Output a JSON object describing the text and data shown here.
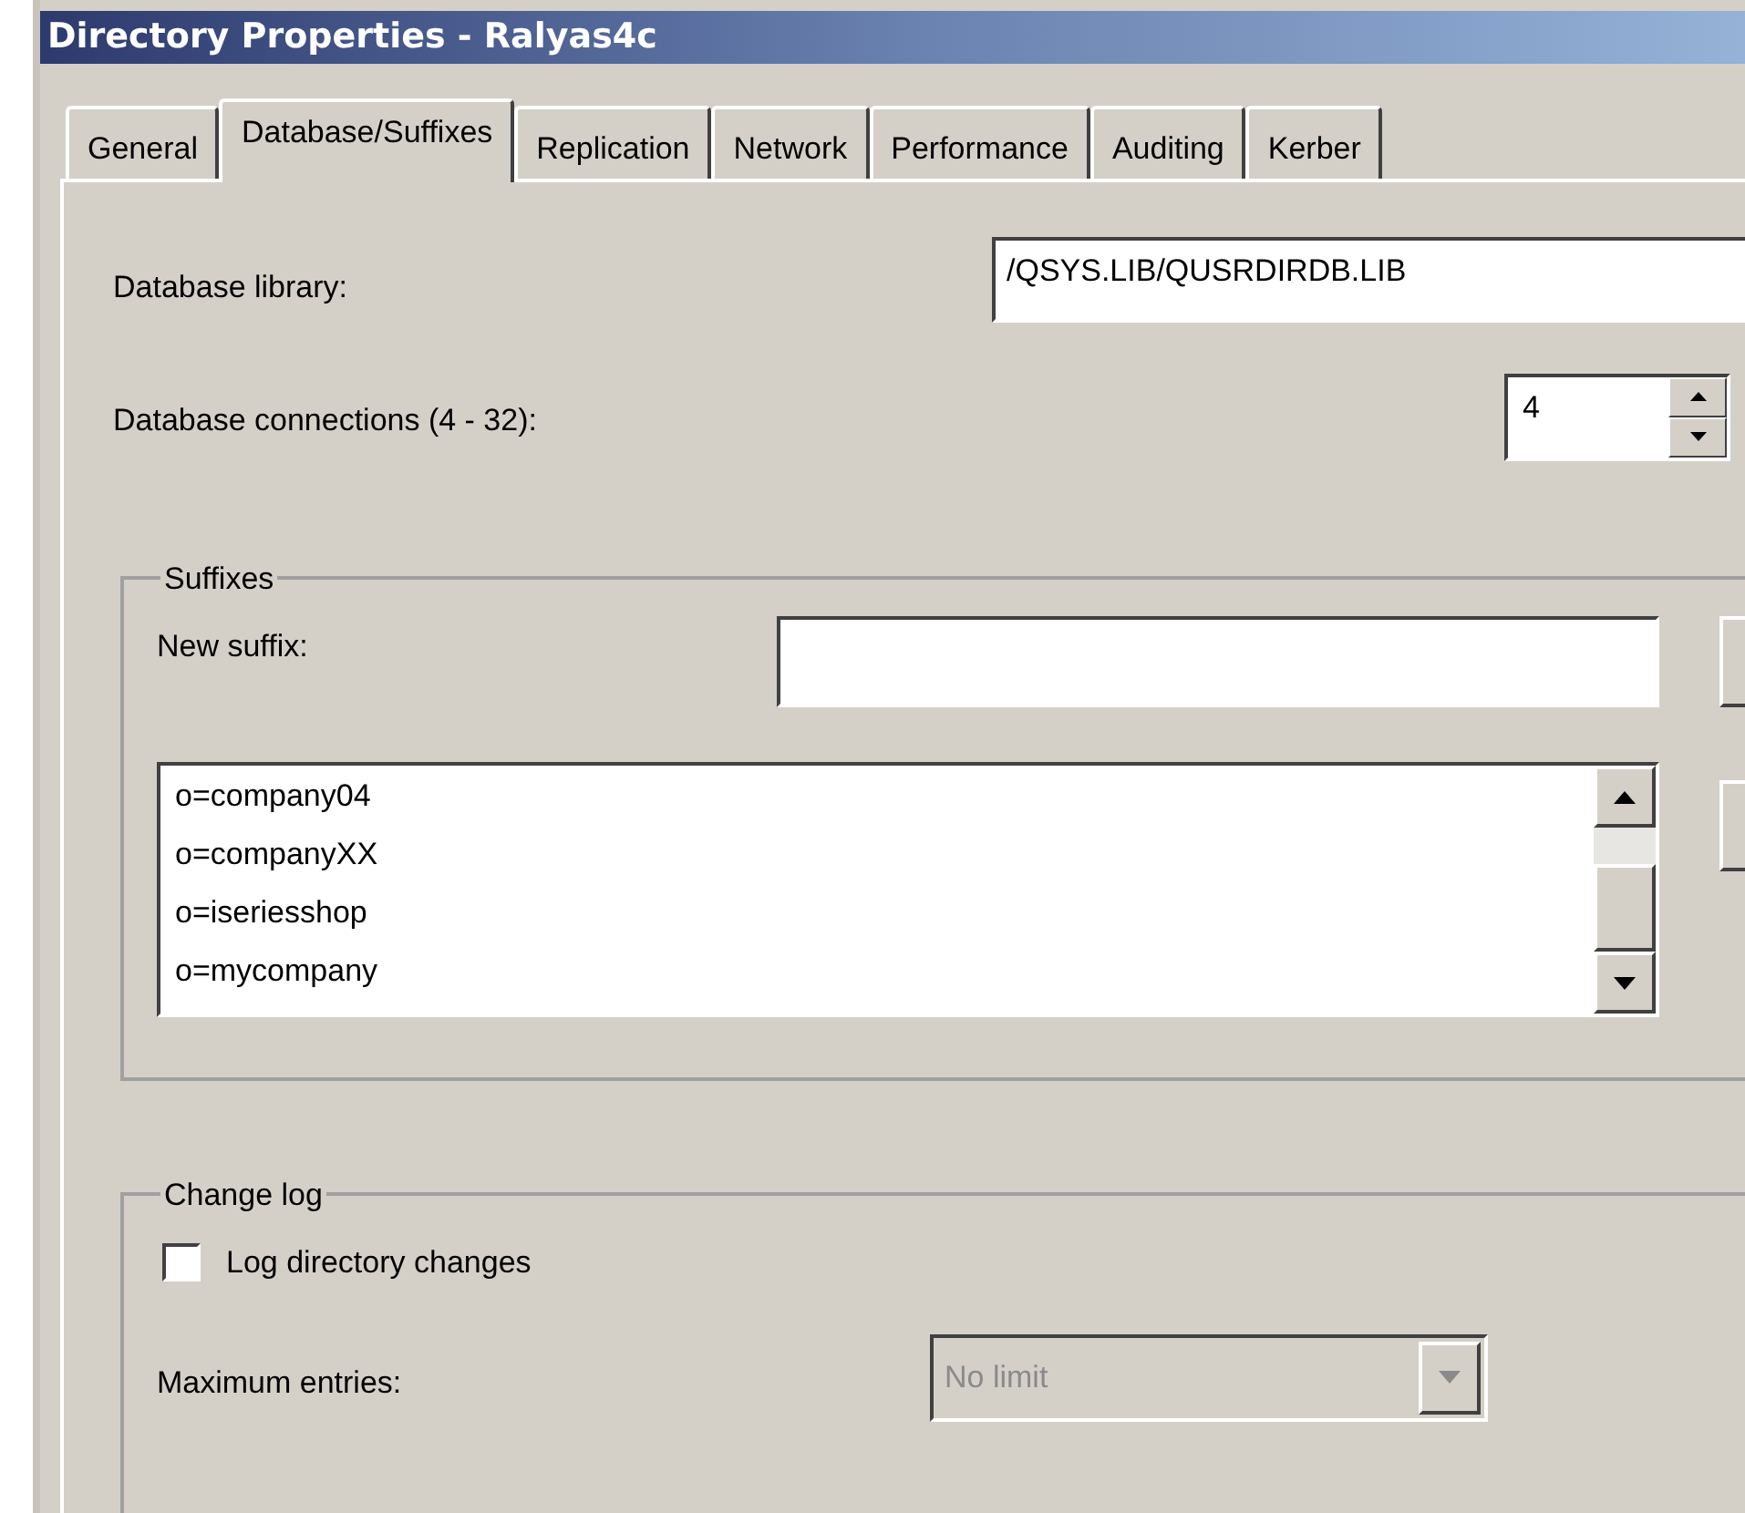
{
  "window": {
    "title": "Directory Properties - Ralyas4c"
  },
  "tabs": [
    {
      "label": "General",
      "selected": false
    },
    {
      "label": "Database/Suffixes",
      "selected": true
    },
    {
      "label": "Replication",
      "selected": false
    },
    {
      "label": "Network",
      "selected": false
    },
    {
      "label": "Performance",
      "selected": false
    },
    {
      "label": "Auditing",
      "selected": false
    },
    {
      "label": "Kerber",
      "selected": false
    }
  ],
  "database_library": {
    "label": "Database library:",
    "value": "/QSYS.LIB/QUSRDIRDB.LIB"
  },
  "database_connections": {
    "label": "Database connections (4 - 32):",
    "value": "4"
  },
  "suffixes": {
    "title": "Suffixes",
    "new_suffix_label": "New suffix:",
    "items": [
      "o=company04",
      "o=companyXX",
      "o=iseriesshop",
      "o=mycompany"
    ]
  },
  "change_log": {
    "title": "Change log",
    "log_changes": {
      "label": "Log directory changes",
      "checked": false
    },
    "maximum_entries": {
      "label": "Maximum entries:",
      "value": "No limit",
      "disabled": true
    }
  }
}
